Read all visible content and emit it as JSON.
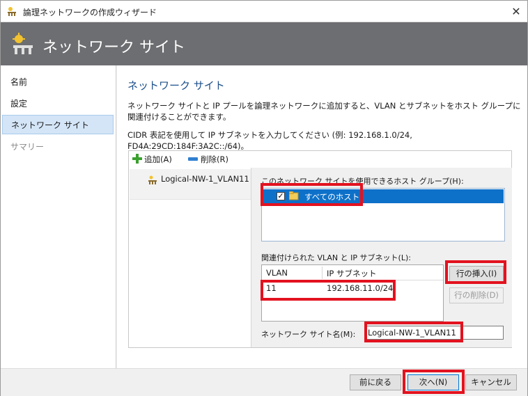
{
  "window": {
    "title": "論理ネットワークの作成ウィザード",
    "close_glyph": "✕"
  },
  "banner": {
    "title": "ネットワーク サイト"
  },
  "sidebar": {
    "items": [
      {
        "label": "名前"
      },
      {
        "label": "設定"
      },
      {
        "label": "ネットワーク サイト"
      },
      {
        "label": "サマリー"
      }
    ]
  },
  "main": {
    "title": "ネットワーク サイト",
    "description": "ネットワーク サイトと IP プールを論理ネットワークに追加すると、VLAN とサブネットをホスト グループに関連付けることができます。",
    "cidr_hint": "CIDR 表記を使用して IP サブネットを入力してください (例: 192.168.1.0/24, FD4A:29CD:184F:3A2C::/64)。"
  },
  "toolbar": {
    "add_label": "追加(A)",
    "remove_label": "削除(R)"
  },
  "sites": [
    {
      "label": "Logical-NW-1_VLAN11"
    }
  ],
  "detail": {
    "host_groups_label": "このネットワーク サイトを使用できるホスト グループ(H):",
    "host_groups": [
      {
        "label": "すべてのホスト",
        "checked": true
      }
    ],
    "vlan_label": "関連付けられた VLAN と IP サブネット(L):",
    "columns": [
      "VLAN",
      "IP サブネット"
    ],
    "rows": [
      {
        "vlan": "11",
        "subnet": "192.168.11.0/24"
      }
    ],
    "insert_row_label": "行の挿入(I)",
    "delete_row_label": "行の削除(D)",
    "site_name_label": "ネットワーク サイト名(M):",
    "site_name_value": "Logical-NW-1_VLAN11"
  },
  "footer": {
    "back_label": "前に戻る",
    "next_label": "次へ(N)",
    "cancel_label": "キャンセル"
  },
  "colors": {
    "banner": "#6d6e71",
    "selection": "#0e71c9",
    "highlight": "#e3121f",
    "title_text": "#1c4f8a"
  }
}
